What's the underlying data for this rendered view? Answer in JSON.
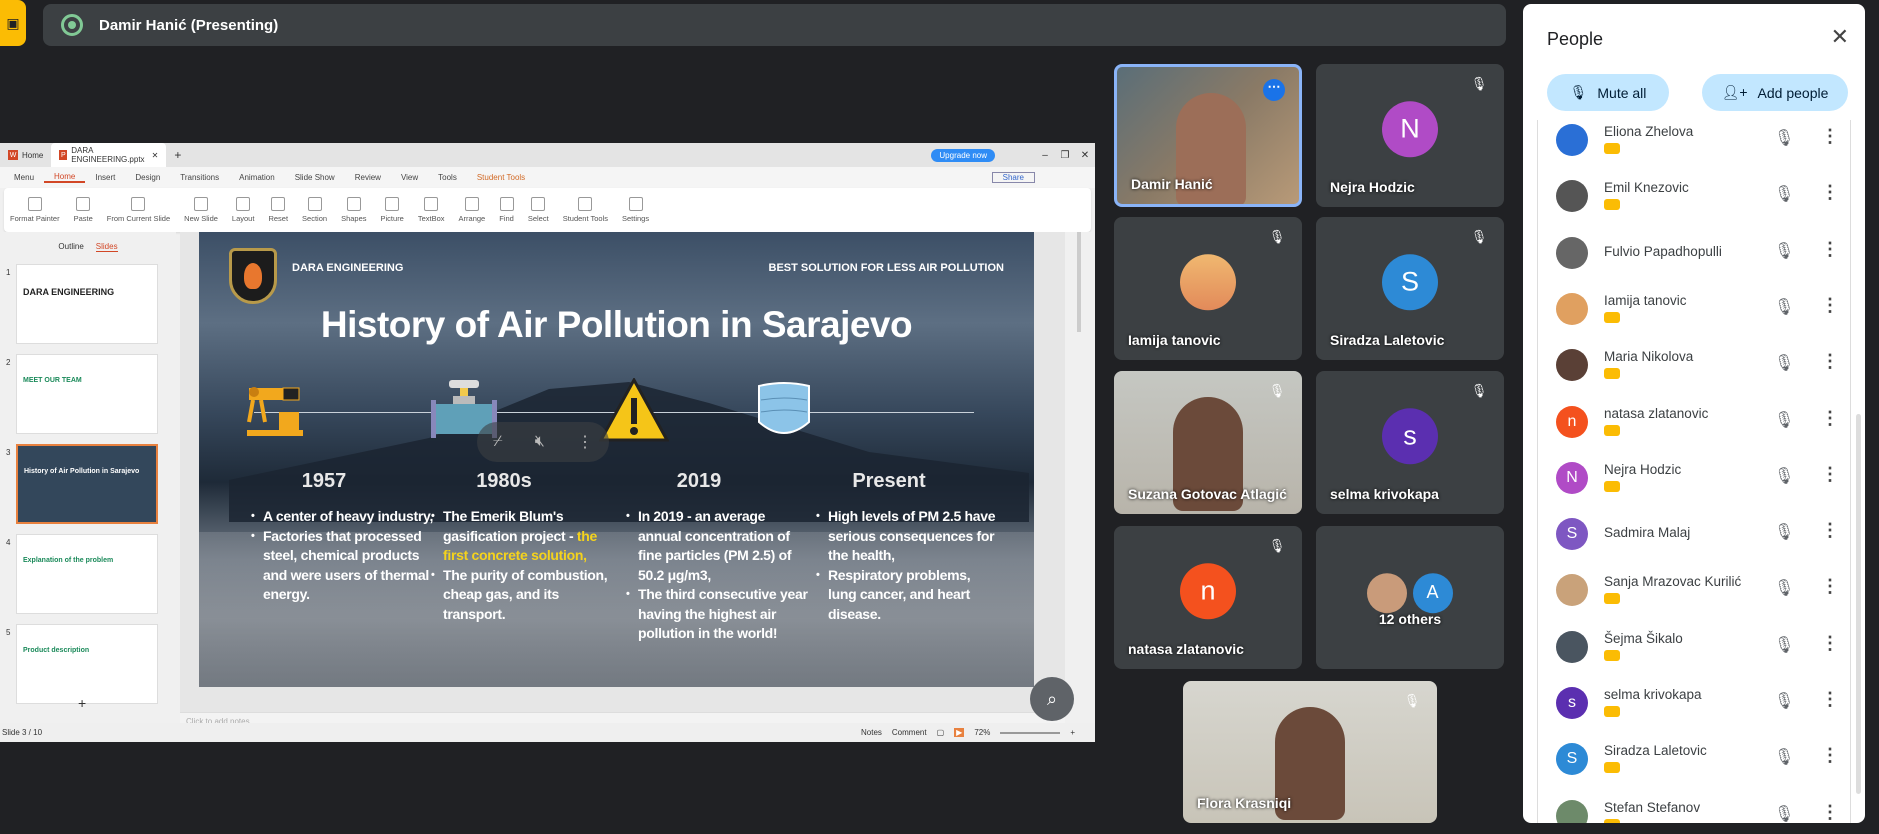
{
  "topbar": {
    "presenter_label": "Damir Hanić (Presenting)",
    "left_icon": "present-off-icon"
  },
  "ppt": {
    "tabs": [
      {
        "label": "Home"
      },
      {
        "label": "DARA ENGINEERING.pptx"
      }
    ],
    "upgrade": "Upgrade now",
    "menu": [
      "Menu",
      "Home",
      "Insert",
      "Design",
      "Transitions",
      "Animation",
      "Slide Show",
      "Review",
      "View",
      "Tools",
      "Student Tools"
    ],
    "share": "Share",
    "ribbon": [
      "Format Painter",
      "Paste",
      "From Current Slide",
      "New Slide",
      "Layout",
      "Reset",
      "Section",
      "Shapes",
      "Picture",
      "TextBox",
      "Arrange",
      "Find",
      "Select",
      "Student Tools",
      "Settings"
    ],
    "side_tabs": [
      "Outline",
      "Slides"
    ],
    "thumbs": [
      {
        "n": "1",
        "t": "DARA ENGINEERING"
      },
      {
        "n": "2",
        "t": "MEET OUR TEAM"
      },
      {
        "n": "3",
        "t": "History of Air Pollution in Sarajevo"
      },
      {
        "n": "4",
        "t": "Explanation of the problem"
      },
      {
        "n": "5",
        "t": "Product description"
      }
    ],
    "notes_placeholder": "Click to add notes",
    "status": "Slide 3 / 10",
    "notes_btn": "Notes",
    "comment_btn": "Comment",
    "zoom": "72%"
  },
  "slide": {
    "brand": "DARA ENGINEERING",
    "tagline": "BEST SOLUTION FOR LESS AIR POLLUTION",
    "title": "History of Air Pollution in Sarajevo",
    "columns": [
      {
        "year": "1957",
        "bullets": [
          [
            "A center of heavy industry,"
          ],
          [
            "Factories that processed steel, chemical products and were users of thermal energy."
          ]
        ]
      },
      {
        "year": "1980s",
        "bullets": [
          [
            "The Emerik Blum's gasification project - ",
            "the first concrete solution,"
          ],
          [
            "The purity of combustion, cheap gas, and its transport."
          ]
        ]
      },
      {
        "year": "2019",
        "bullets": [
          [
            "In 2019 - an average annual concentration of fine particles (PM 2.5) of 50.2 μg/m3,"
          ],
          [
            "The third consecutive year having the highest air pollution in the world!"
          ]
        ]
      },
      {
        "year": "Present",
        "bullets": [
          [
            "High levels of PM 2.5 have serious consequences for the health,"
          ],
          [
            "Respiratory problems, lung cancer, and heart disease."
          ]
        ]
      }
    ]
  },
  "tiles": [
    {
      "name": "Damir Hanić",
      "type": "video"
    },
    {
      "name": "Nejra Hodzic",
      "initial": "N",
      "color": "#b04bc6"
    },
    {
      "name": "Iamija tanovic",
      "type": "photo"
    },
    {
      "name": "Siradza Laletovic",
      "initial": "S",
      "color": "#2d8ad6"
    },
    {
      "name": "Suzana Gotovac Atlagić",
      "type": "video"
    },
    {
      "name": "selma krivokapa",
      "initial": "s",
      "color": "#5b2fb0"
    },
    {
      "name": "natasa zlatanovic",
      "initial": "n",
      "color": "#f4511e"
    },
    {
      "name": "12 others",
      "initial": "A",
      "color": "#2d8ad6"
    },
    {
      "name": "Flora Krasniqi",
      "type": "video"
    }
  ],
  "people": {
    "title": "People",
    "mute_all": "Mute all",
    "add_people": "Add people",
    "list": [
      {
        "name": "Eliona Zhelova",
        "color": "#2a6fd6",
        "badge": true
      },
      {
        "name": "Emil Knezovic",
        "color": "#555",
        "badge": true
      },
      {
        "name": "Fulvio Papadhopulli",
        "color": "#666",
        "badge": false
      },
      {
        "name": "Iamija tanovic",
        "color": "#e0a060",
        "badge": true
      },
      {
        "name": "Maria Nikolova",
        "color": "#5a4036",
        "badge": true
      },
      {
        "name": "natasa zlatanovic",
        "initial": "n",
        "color": "#f4511e",
        "badge": true
      },
      {
        "name": "Nejra Hodzic",
        "initial": "N",
        "color": "#b04bc6",
        "badge": true
      },
      {
        "name": "Sadmira Malaj",
        "initial": "S",
        "color": "#7e57c2",
        "badge": false
      },
      {
        "name": "Sanja Mrazovac Kurilić",
        "color": "#c9a27a",
        "badge": true
      },
      {
        "name": "Šejma Šikalo",
        "color": "#4a5560",
        "badge": true
      },
      {
        "name": "selma krivokapa",
        "initial": "s",
        "color": "#5b2fb0",
        "badge": true
      },
      {
        "name": "Siradza Laletovic",
        "initial": "S",
        "color": "#2d8ad6",
        "badge": true
      },
      {
        "name": "Stefan Stefanov",
        "color": "#6d8a6a",
        "badge": true
      }
    ]
  },
  "colors": {
    "meet_bg": "#202124",
    "tile_bg": "#3c4043",
    "accent_blue": "#c2e7ff",
    "badge": "#fbbc04",
    "wps_red": "#d24726"
  }
}
